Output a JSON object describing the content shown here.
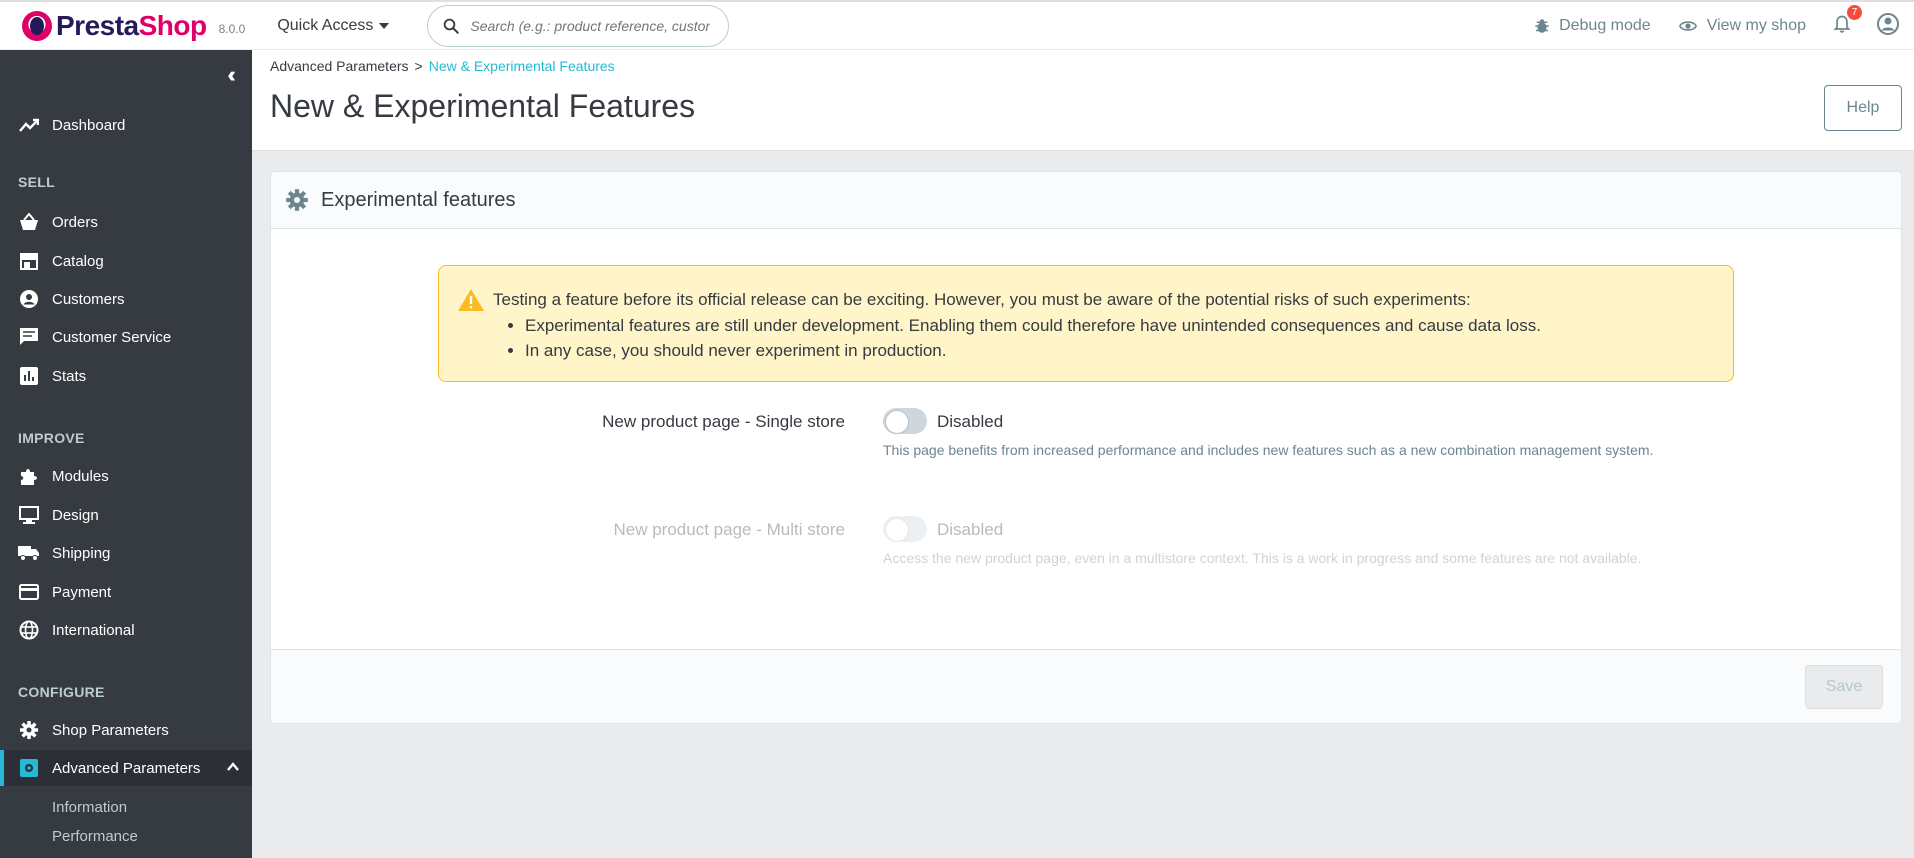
{
  "header": {
    "logo_text_dark": "Presta",
    "logo_text_pink": "Shop",
    "version": "8.0.0",
    "quick_access": "Quick Access",
    "search_placeholder": "Search (e.g.: product reference, custon",
    "debug_mode": "Debug mode",
    "view_shop": "View my shop",
    "notification_count": "7"
  },
  "sidebar": {
    "dashboard": "Dashboard",
    "sections": {
      "sell": "SELL",
      "improve": "IMPROVE",
      "configure": "CONFIGURE"
    },
    "items": {
      "orders": "Orders",
      "catalog": "Catalog",
      "customers": "Customers",
      "customer_service": "Customer Service",
      "stats": "Stats",
      "modules": "Modules",
      "design": "Design",
      "shipping": "Shipping",
      "payment": "Payment",
      "international": "International",
      "shop_parameters": "Shop Parameters",
      "advanced_parameters": "Advanced Parameters"
    },
    "sub_items": {
      "information": "Information",
      "performance": "Performance"
    },
    "accent_color": "#25b9d7"
  },
  "page": {
    "breadcrumb_parent": "Advanced Parameters",
    "breadcrumb_sep": ">",
    "breadcrumb_current": "New & Experimental Features",
    "title": "New & Experimental Features",
    "help": "Help"
  },
  "card": {
    "title": "Experimental features",
    "alert": {
      "intro": "Testing a feature before its official release can be exciting. However, you must be aware of the potential risks of such experiments:",
      "bullet1": "Experimental features are still under development. Enabling them could therefore have unintended consequences and cause data loss.",
      "bullet2": "In any case, you should never experiment in production."
    },
    "features": [
      {
        "label": "New product page - Single store",
        "state": "Disabled",
        "help": "This page benefits from increased performance and includes new features such as a new combination management system."
      },
      {
        "label": "New product page - Multi store",
        "state": "Disabled",
        "help": "Access the new product page, even in a multistore context. This is a work in progress and some features are not available."
      }
    ],
    "save": "Save"
  }
}
